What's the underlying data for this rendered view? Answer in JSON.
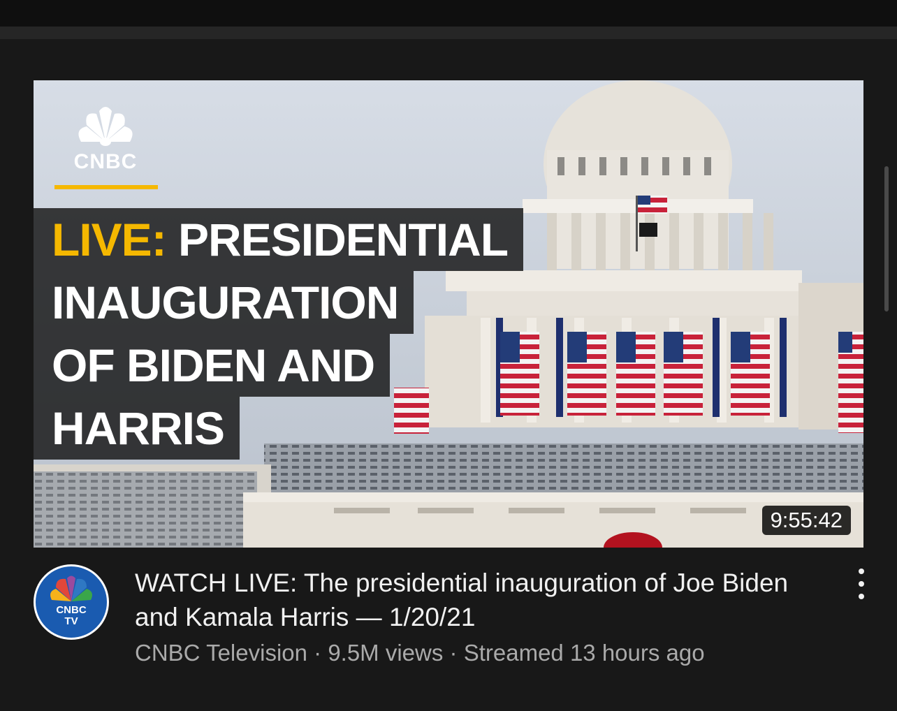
{
  "video": {
    "thumbnail": {
      "brand_logo": "CNBC",
      "headline_lines": [
        {
          "prefix": "LIVE:",
          "text": " PRESIDENTIAL"
        },
        {
          "prefix": "",
          "text": "INAUGURATION"
        },
        {
          "prefix": "",
          "text": "OF BIDEN AND"
        },
        {
          "prefix": "",
          "text": "HARRIS"
        }
      ],
      "duration": "9:55:42"
    },
    "title": "WATCH LIVE: The presidential inauguration of Joe Biden and Kamala Harris — 1/20/21",
    "channel": "CNBC Television",
    "views": "9.5M views",
    "age": "Streamed 13 hours ago",
    "separator": " · ",
    "avatar_text_1": "CNBC",
    "avatar_text_2": "TV",
    "menu_icon": "more-vert-icon"
  },
  "colors": {
    "background": "#181818",
    "accent_yellow": "#f5b800",
    "title_text": "#f1f1f1",
    "meta_text": "#aaaaaa"
  }
}
